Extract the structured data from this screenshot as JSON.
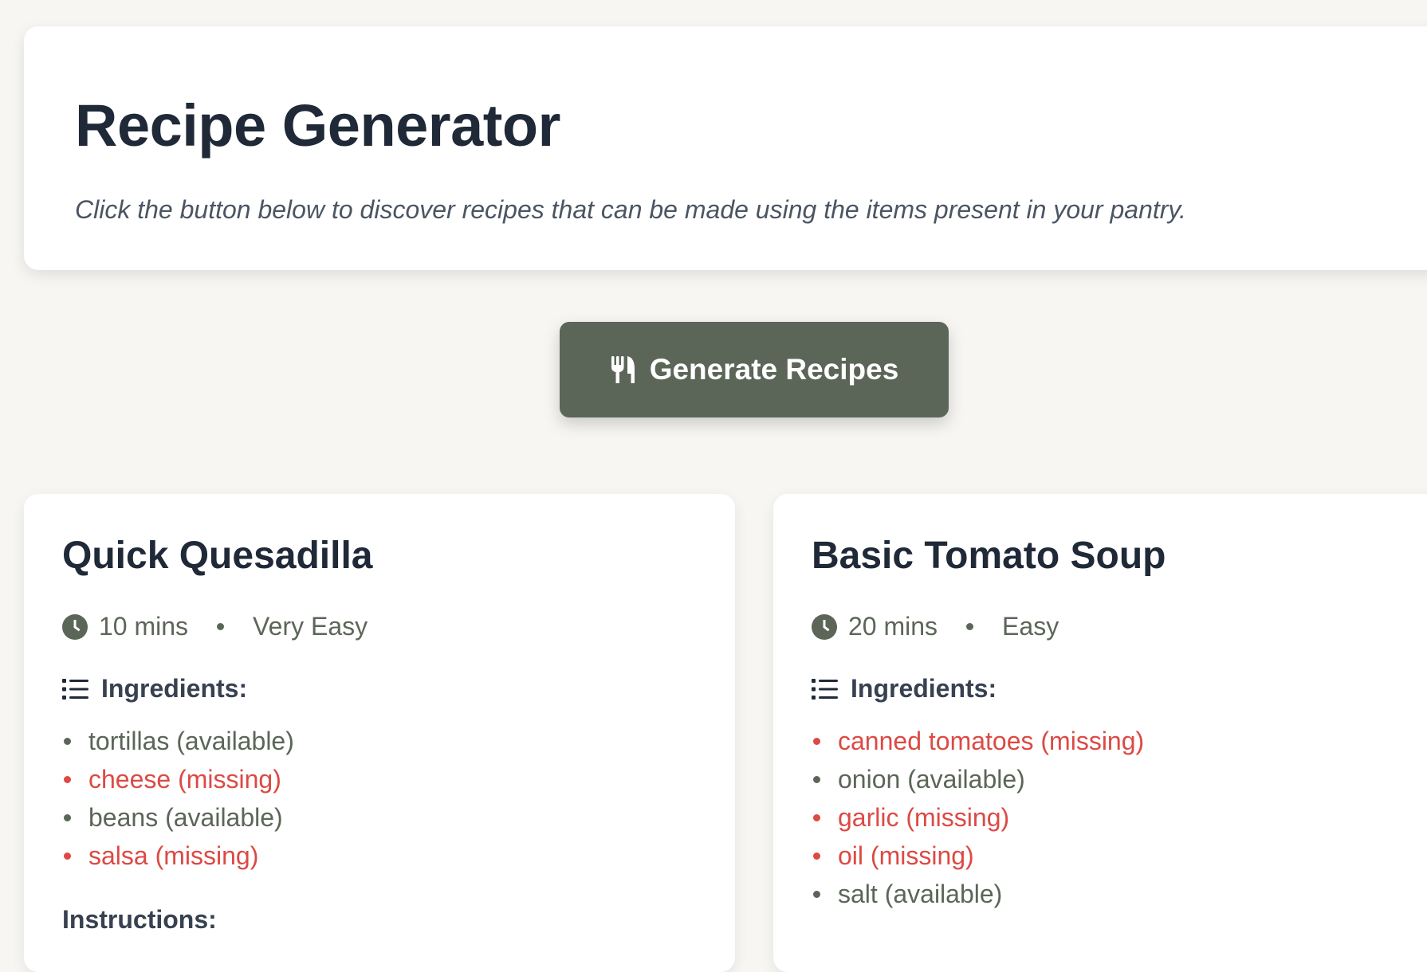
{
  "header": {
    "title": "Recipe Generator",
    "subtitle": "Click the button below to discover recipes that can be made using the items present in your pantry."
  },
  "generate_button": {
    "label": "Generate Recipes",
    "icon": "utensils-icon"
  },
  "labels": {
    "ingredients": "Ingredients:",
    "instructions": "Instructions:"
  },
  "colors": {
    "accent": "#5b6658",
    "missing": "#dc4a44",
    "title": "#1f2937",
    "background": "#f7f6f3"
  },
  "recipes": [
    {
      "title": "Quick Quesadilla",
      "time": "10 mins",
      "difficulty": "Very Easy",
      "ingredients": [
        {
          "text": "tortillas (available)",
          "status": "available"
        },
        {
          "text": "cheese (missing)",
          "status": "missing"
        },
        {
          "text": "beans (available)",
          "status": "available"
        },
        {
          "text": "salsa (missing)",
          "status": "missing"
        }
      ]
    },
    {
      "title": "Basic Tomato Soup",
      "time": "20 mins",
      "difficulty": "Easy",
      "ingredients": [
        {
          "text": "canned tomatoes (missing)",
          "status": "missing"
        },
        {
          "text": "onion (available)",
          "status": "available"
        },
        {
          "text": "garlic (missing)",
          "status": "missing"
        },
        {
          "text": "oil (missing)",
          "status": "missing"
        },
        {
          "text": "salt (available)",
          "status": "available"
        }
      ]
    }
  ]
}
